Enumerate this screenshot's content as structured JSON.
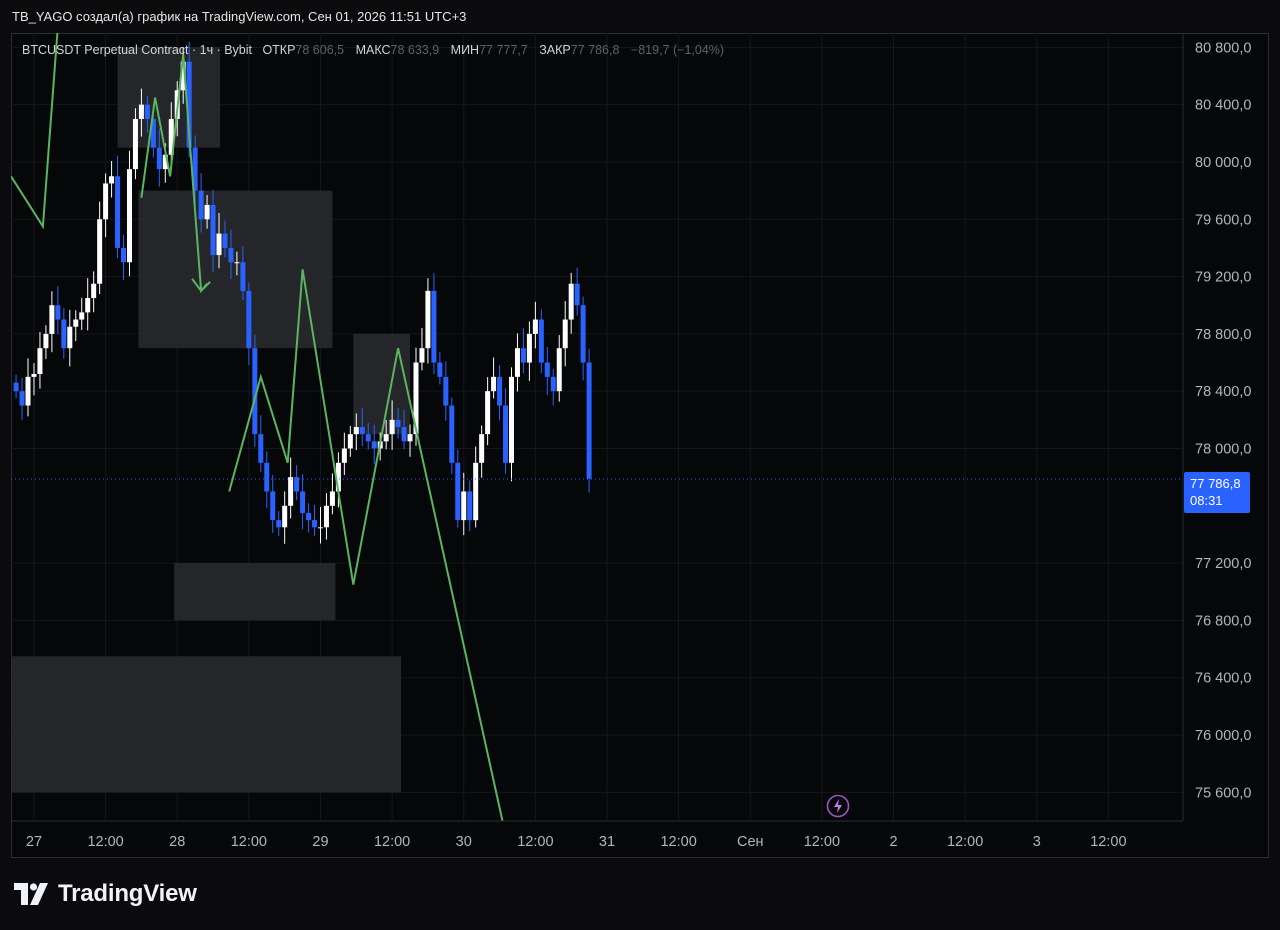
{
  "header": {
    "credit": "TB_YAGO создал(а) график на TradingView.com, Сен 01, 2026 11:51 UTC+3"
  },
  "legend": {
    "symbol": "BTCUSDT Perpetual Contract",
    "interval": "1ч",
    "exchange": "Bybit",
    "open_label": "ОТКР",
    "open_value": "78 606,5",
    "high_label": "МАКС",
    "high_value": "78 633,9",
    "low_label": "МИН",
    "low_value": "77 777,7",
    "close_label": "ЗАКР",
    "close_value": "77 786,8",
    "change": "−819,7 (−1,04%)"
  },
  "price_tag": {
    "price": "77 786,8",
    "countdown": "08:31"
  },
  "brand": {
    "name": "TradingView"
  },
  "colors": {
    "up": "#ffffff",
    "down": "#2962ff",
    "projection": "#5ab55e",
    "zone": "#2a2c30",
    "grid": "#15171c",
    "text": "#b2b5be",
    "accent": "#2962ff"
  },
  "chart_data": {
    "type": "candlestick",
    "ylim": [
      75400,
      80900
    ],
    "y_ticks": [
      {
        "value": 80800,
        "label": "80 800,0"
      },
      {
        "value": 80400,
        "label": "80 400,0"
      },
      {
        "value": 80000,
        "label": "80 000,0"
      },
      {
        "value": 79600,
        "label": "79 600,0"
      },
      {
        "value": 79200,
        "label": "79 200,0"
      },
      {
        "value": 78800,
        "label": "78 800,0"
      },
      {
        "value": 78400,
        "label": "78 400,0"
      },
      {
        "value": 78000,
        "label": "78 000,0"
      },
      {
        "value": 77200,
        "label": "77 200,0"
      },
      {
        "value": 76800,
        "label": "76 800,0"
      },
      {
        "value": 76400,
        "label": "76 400,0"
      },
      {
        "value": 76000,
        "label": "76 000,0"
      },
      {
        "value": 75600,
        "label": "75 600,0"
      }
    ],
    "x_ticks": [
      {
        "t": 19,
        "label": "27"
      },
      {
        "t": 31,
        "label": "12:00"
      },
      {
        "t": 43,
        "label": "28"
      },
      {
        "t": 55,
        "label": "12:00"
      },
      {
        "t": 67,
        "label": "29"
      },
      {
        "t": 79,
        "label": "12:00"
      },
      {
        "t": 91,
        "label": "30"
      },
      {
        "t": 103,
        "label": "12:00"
      },
      {
        "t": 115,
        "label": "31"
      },
      {
        "t": 127,
        "label": "12:00"
      },
      {
        "t": 139,
        "label": "Сен"
      },
      {
        "t": 151,
        "label": "12:00"
      },
      {
        "t": 163,
        "label": "2"
      },
      {
        "t": 175,
        "label": "12:00"
      },
      {
        "t": 187,
        "label": "3"
      },
      {
        "t": 199,
        "label": "12:00"
      }
    ],
    "x_range": [
      15.15,
      211.5
    ],
    "last_price": 77786.8,
    "closes": [
      78400,
      78300,
      78500,
      78520,
      78700,
      78800,
      79000,
      78900,
      78700,
      78850,
      78900,
      78950,
      79050,
      79150,
      79600,
      79850,
      79900,
      79400,
      79300,
      79950,
      80300,
      80400,
      80300,
      80100,
      79950,
      80050,
      80300,
      80500,
      80700,
      80100,
      79800,
      79600,
      79700,
      79350,
      79500,
      79400,
      79300,
      79300,
      79100,
      78700,
      78100,
      77900,
      77700,
      77500,
      77450,
      77600,
      77800,
      77700,
      77550,
      77500,
      77450,
      77450,
      77600,
      77700,
      77900,
      78000,
      78100,
      78150,
      78100,
      78050,
      78000,
      78050,
      78100,
      78200,
      78150,
      78050,
      78100,
      78600,
      78700,
      79100,
      78600,
      78500,
      78300,
      77900,
      77500,
      77700,
      77500,
      77900,
      78100,
      78400,
      78500,
      78300,
      77900,
      78500,
      78700,
      78600,
      78800,
      78900,
      78600,
      78500,
      78400,
      78700,
      78900,
      79150,
      79000,
      78600,
      77790
    ],
    "zones": [
      {
        "t0": 33,
        "t1": 50.2,
        "top": 80800,
        "bottom": 80100
      },
      {
        "t0": 36.5,
        "t1": 69,
        "top": 79800,
        "bottom": 78700
      },
      {
        "t0": 72.5,
        "t1": 82,
        "top": 78800,
        "bottom": 78100
      },
      {
        "t0": 42.5,
        "t1": 69.5,
        "top": 77200,
        "bottom": 76800
      },
      {
        "t0": 15.15,
        "t1": 80.5,
        "top": 76550,
        "bottom": 75600
      }
    ],
    "projection": [
      {
        "t": 15.15,
        "p": 79900
      },
      {
        "t": 20.5,
        "p": 79550
      },
      {
        "t": 24,
        "p": 81500
      }
    ],
    "projection_2": [
      {
        "t": 37,
        "p": 79750
      },
      {
        "t": 39.3,
        "p": 80450
      },
      {
        "t": 41.8,
        "p": 79900
      },
      {
        "t": 44,
        "p": 80750
      },
      {
        "t": 47,
        "p": 79100
      },
      {
        "t": 48,
        "p": 79150
      }
    ],
    "projection_3": [
      {
        "t": 51.7,
        "p": 77700
      },
      {
        "t": 57,
        "p": 78500
      },
      {
        "t": 61.5,
        "p": 77900
      },
      {
        "t": 64,
        "p": 79250
      },
      {
        "t": 72.5,
        "p": 77050
      },
      {
        "t": 80,
        "p": 78700
      },
      {
        "t": 97.5,
        "p": 75400
      }
    ]
  }
}
